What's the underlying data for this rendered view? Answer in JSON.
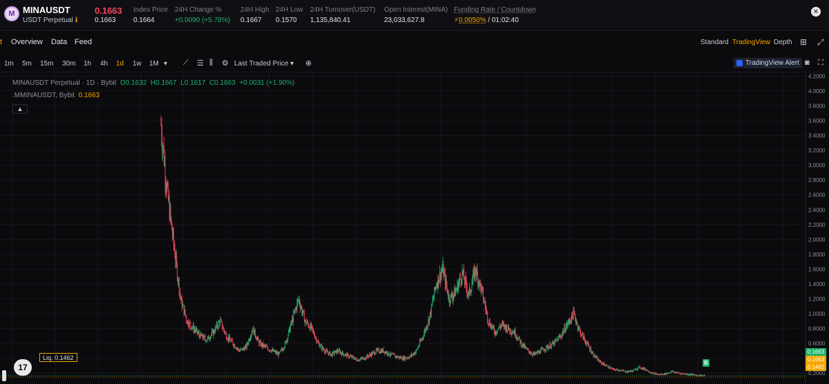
{
  "ticker": {
    "logo_letter": "M",
    "symbol": "MINAUSDT",
    "contract": "USDT Perpetual",
    "info_icon": "info-icon",
    "last_price": "0.1663",
    "mark_price": "0.1664",
    "last_price_sub": "0.1663",
    "stats": [
      {
        "label": "Index Price",
        "value": "0.1664"
      },
      {
        "label": "24H Change %",
        "value": "+0.0090 (+5.78%)"
      },
      {
        "label": "24H High",
        "value": "0.1667"
      },
      {
        "label": "24H Low",
        "value": "0.1570"
      },
      {
        "label": "24H Turnover(USDT)",
        "value": "1,135,840.41"
      },
      {
        "label": "Open Interest(MINA)",
        "value": "23,033,627.8"
      }
    ],
    "funding_label": "Funding Rate / Countdown",
    "funding_rate": "0.0050%",
    "funding_sep": "/",
    "countdown": "01:02:40",
    "colors": {
      "down": "#f6465d",
      "up": "#20b26c",
      "accent": "#f7a600"
    }
  },
  "tabs": {
    "first": "t",
    "items": [
      "Overview",
      "Data",
      "Feed"
    ],
    "views": [
      "Standard",
      "TradingView",
      "Depth"
    ],
    "active_view": "TradingView",
    "icons": [
      "grid-settings-icon",
      "expand-icon"
    ]
  },
  "toolbar": {
    "intervals": [
      "1m",
      "5m",
      "15m",
      "30m",
      "1h",
      "4h",
      "1d",
      "1w",
      "1M"
    ],
    "active_interval": "1d",
    "more_intervals_icon": "▾",
    "icons": [
      "indicators-icon",
      "chart-type-icon",
      "candles-icon",
      "settings-icon"
    ],
    "price_source": "Last Traded Price",
    "price_source_caret": "▾",
    "add_icon": "⊕",
    "alert_label": "TradingView Alert",
    "camera_icon": "camera-icon",
    "fullscreen_icon": "fullscreen-icon"
  },
  "chart": {
    "legend_main_title": "MINAUSDT Perpetual · 1D · Bybit",
    "legend_ohlc": {
      "o": "O0.1632",
      "h": "H0.1667",
      "l": "L0.1617",
      "c": "C0.1663",
      "chg": "+0.0031 (+1.90%)"
    },
    "legend_mark_title": ".MMINAUSDT, Bybit",
    "legend_mark_value": "0.1663",
    "liq_label": "Liq. 0.1462",
    "tv_logo": "17",
    "trade_marker": "B",
    "price_tags": [
      {
        "value": "0.1663",
        "color": "#20b26c"
      },
      {
        "value": "0.1663",
        "color": "#f7a600"
      },
      {
        "value": "0.1462",
        "color": "#f7a600"
      }
    ],
    "y_axis_ticks": [
      "4.2000",
      "4.0000",
      "3.8000",
      "3.6000",
      "3.4000",
      "3.2000",
      "3.0000",
      "2.8000",
      "2.6000",
      "2.4000",
      "2.2000",
      "2.0000",
      "1.8000",
      "1.6000",
      "1.4000",
      "1.2000",
      "1.0000",
      "0.8000",
      "0.6000",
      "0.4000",
      "0.2000"
    ]
  },
  "chart_data": {
    "type": "candlestick",
    "title": "MINAUSDT Perpetual · 1D · Bybit",
    "ylim": [
      0.1,
      4.25
    ],
    "approx_close_path": [
      3.55,
      2.6,
      1.9,
      1.2,
      0.9,
      0.8,
      0.7,
      0.65,
      0.75,
      0.9,
      0.7,
      0.6,
      0.5,
      0.55,
      0.8,
      0.6,
      0.55,
      0.5,
      0.45,
      0.6,
      0.9,
      1.2,
      0.9,
      0.8,
      0.6,
      0.5,
      0.45,
      0.5,
      0.45,
      0.42,
      0.38,
      0.4,
      0.45,
      0.5,
      0.5,
      0.45,
      0.42,
      0.4,
      0.42,
      0.5,
      0.7,
      0.95,
      1.4,
      1.6,
      1.2,
      1.3,
      1.55,
      1.25,
      1.6,
      1.3,
      0.9,
      0.75,
      0.85,
      0.8,
      0.75,
      0.6,
      0.5,
      0.45,
      0.5,
      0.55,
      0.6,
      0.7,
      0.85,
      1.0,
      0.75,
      0.6,
      0.45,
      0.35,
      0.3,
      0.25,
      0.24,
      0.22,
      0.23,
      0.28,
      0.25,
      0.2,
      0.18,
      0.19,
      0.22,
      0.2,
      0.19,
      0.18,
      0.17,
      0.1663
    ]
  }
}
